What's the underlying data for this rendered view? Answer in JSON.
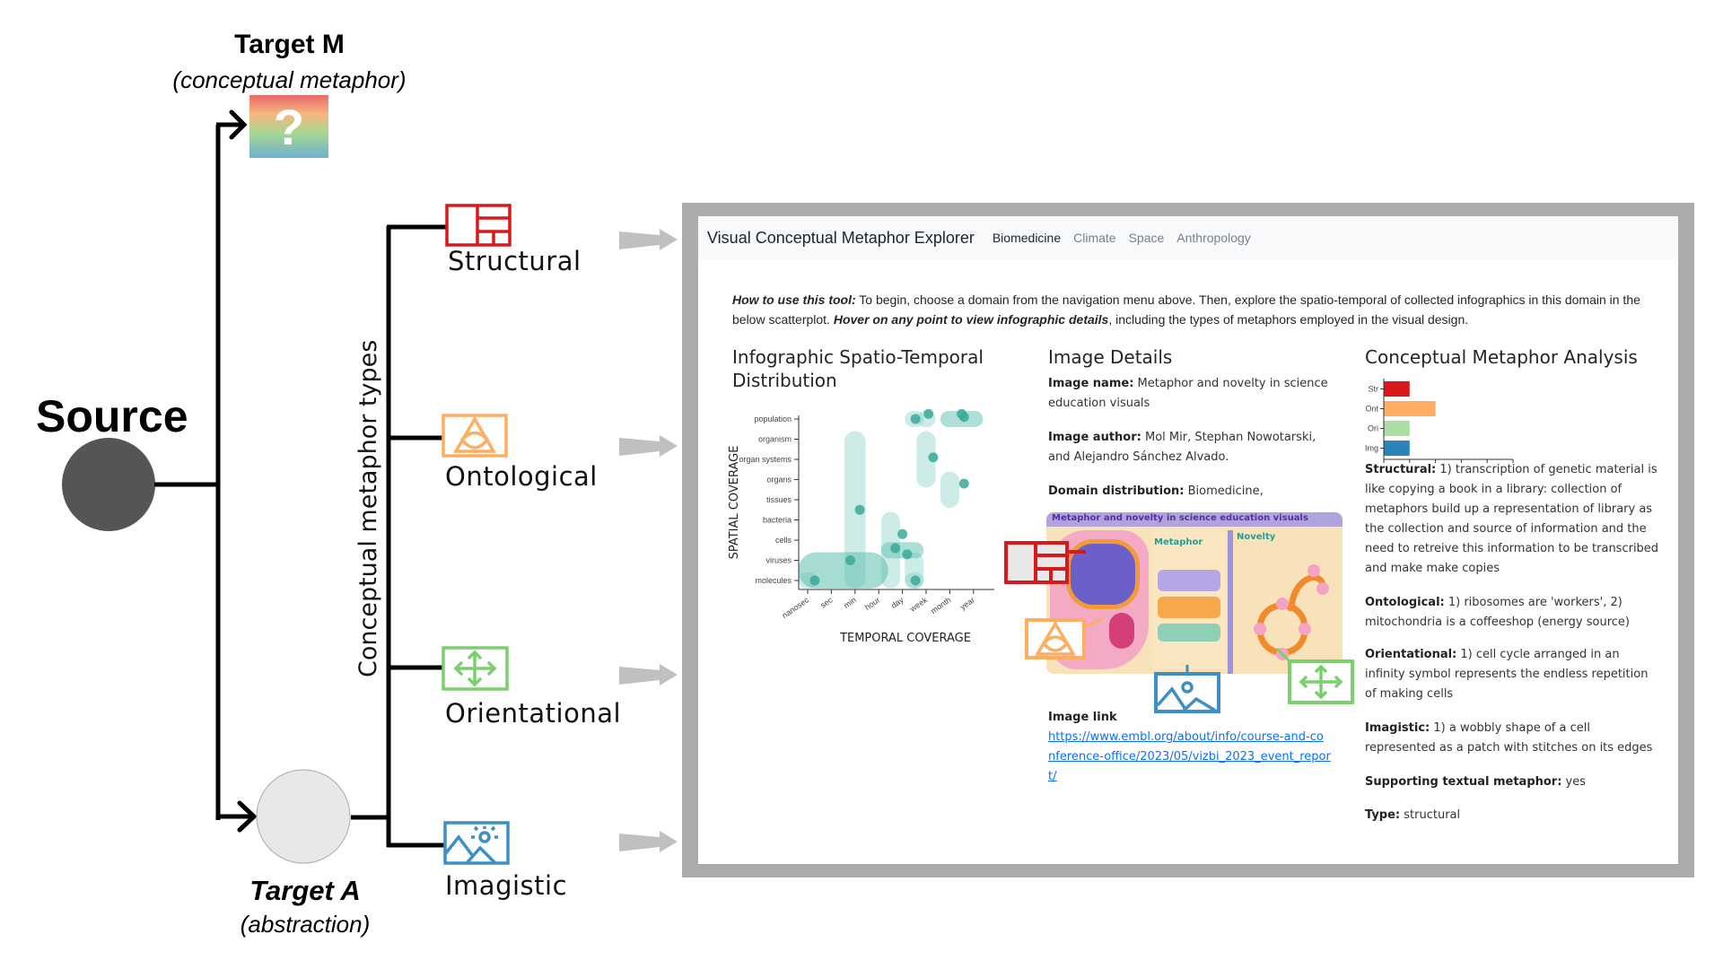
{
  "diagram": {
    "source": {
      "label": "Source"
    },
    "target_m": {
      "label": "Target M",
      "sublabel": "(conceptual metaphor)",
      "placeholder_glyph": "?"
    },
    "target_a": {
      "label": "Target A",
      "sublabel": "(abstraction)"
    },
    "branch_label": "Conceptual metaphor types",
    "types": [
      {
        "label": "Structural",
        "icon": "structural-grid-icon",
        "color": "#d7191c"
      },
      {
        "label": "Ontological",
        "icon": "ontological-triquetra-icon",
        "color": "#fdae61"
      },
      {
        "label": "Orientational",
        "icon": "orientational-arrows-icon",
        "color": "#7ccf6e"
      },
      {
        "label": "Imagistic",
        "icon": "imagistic-landscape-icon",
        "color": "#3d8fc4"
      }
    ]
  },
  "app": {
    "title": "Visual Conceptual Metaphor Explorer",
    "nav": [
      {
        "label": "Biomedicine",
        "active": true
      },
      {
        "label": "Climate",
        "active": false
      },
      {
        "label": "Space",
        "active": false
      },
      {
        "label": "Anthropology",
        "active": false
      }
    ],
    "intro": {
      "lead": "How to use this tool:",
      "part1": " To begin, choose a domain from the navigation menu above. Then, explore the spatio-temporal of collected infographics in this domain in the below scatterplot. ",
      "emph": "Hover on any point to view infographic details",
      "part2": ", including the types of metaphors employed in the visual design."
    },
    "scatter": {
      "title": "Infographic Spatio-Temporal Distribution"
    },
    "details": {
      "title": "Image Details",
      "name_label": "Image name:",
      "name_value": " Metaphor and novelty in science education visuals",
      "author_label": "Image author:",
      "author_value": " Mol Mir, Stephan Nowotarski, and Alejandro Sánchez Alvado.",
      "domain_label": "Domain distribution:",
      "domain_value": " Biomedicine,",
      "poster_title": "Metaphor and novelty in science education visuals",
      "poster_sections": [
        "Metaphor",
        "Novelty"
      ],
      "link_label": "Image link",
      "link_url": "https://www.embl.org/about/info/course-and-conference-office/2023/05/vizbi_2023_event_report/"
    },
    "analysis": {
      "title": "Conceptual Metaphor Analysis",
      "entries": [
        {
          "label": "Structural:",
          "text": " 1) transcription of genetic material is like copying a book in a library: collection of metaphors build up a representation of library as the collection and source of information and the need to retreive this information to be transcribed and make make copies"
        },
        {
          "label": "Ontological:",
          "text": " 1) ribosomes are 'workers', 2) mitochondria is a coffeeshop (energy source)"
        },
        {
          "label": "Orientational:",
          "text": " 1) cell cycle arranged in an infinity symbol represents the endless repetition of making cells"
        },
        {
          "label": "Imagistic:",
          "text": " 1) a wobbly shape of a cell represented as a patch with stitches on its edges"
        },
        {
          "label": "Supporting textual metaphor:",
          "text": " yes"
        },
        {
          "label": "Type:",
          "text": " structural"
        }
      ]
    }
  },
  "chart_data": [
    {
      "type": "scatter",
      "title": "Infographic Spatio-Temporal Distribution",
      "xlabel": "TEMPORAL COVERAGE",
      "ylabel": "SPATIAL COVERAGE",
      "x_categories": [
        "nanosec",
        "sec",
        "min",
        "hour",
        "day",
        "week",
        "month",
        "year"
      ],
      "y_categories": [
        "molecules",
        "viruses",
        "cells",
        "bacteria",
        "tissues",
        "organs",
        "organ systems",
        "organism",
        "population"
      ],
      "ranges": [
        {
          "x": [
            -0.4,
            3.4
          ],
          "y": [
            -0.4,
            1.4
          ],
          "emphasis": "strong"
        },
        {
          "x": [
            1.55,
            2.45
          ],
          "y": [
            -0.4,
            7.4
          ],
          "emphasis": "light"
        },
        {
          "x": [
            3.1,
            3.9
          ],
          "y": [
            -0.4,
            3.4
          ],
          "emphasis": "light"
        },
        {
          "x": [
            3.1,
            4.9
          ],
          "y": [
            1.1,
            1.9
          ],
          "emphasis": "medium"
        },
        {
          "x": [
            4.1,
            4.9
          ],
          "y": [
            -0.4,
            1.4
          ],
          "emphasis": "light"
        },
        {
          "x": [
            -0.4,
            0.4
          ],
          "y": [
            -0.4,
            0.4
          ],
          "emphasis": "light"
        },
        {
          "x": [
            4.1,
            4.9
          ],
          "y": [
            -0.4,
            0.4
          ],
          "emphasis": "light"
        },
        {
          "x": [
            4.6,
            5.4
          ],
          "y": [
            4.6,
            7.4
          ],
          "emphasis": "light"
        },
        {
          "x": [
            5.6,
            6.4
          ],
          "y": [
            3.6,
            5.4
          ],
          "emphasis": "light"
        },
        {
          "x": [
            4.1,
            4.9
          ],
          "y": [
            7.6,
            8.4
          ],
          "emphasis": "light"
        },
        {
          "x": [
            4.6,
            5.4
          ],
          "y": [
            7.6,
            8.4
          ],
          "emphasis": "light"
        },
        {
          "x": [
            5.6,
            7.4
          ],
          "y": [
            7.6,
            8.4
          ],
          "emphasis": "medium"
        }
      ],
      "points": [
        {
          "x": 0.3,
          "y": 0
        },
        {
          "x": 1.8,
          "y": 1
        },
        {
          "x": 2.2,
          "y": 3.5
        },
        {
          "x": 3.7,
          "y": 1.6
        },
        {
          "x": 4.0,
          "y": 2.3
        },
        {
          "x": 4.2,
          "y": 1.3
        },
        {
          "x": 4.55,
          "y": 0
        },
        {
          "x": 4.55,
          "y": 8
        },
        {
          "x": 5.1,
          "y": 8.25
        },
        {
          "x": 5.3,
          "y": 6.1
        },
        {
          "x": 6.5,
          "y": 8.25
        },
        {
          "x": 6.6,
          "y": 8.1
        },
        {
          "x": 6.6,
          "y": 4.8
        }
      ]
    },
    {
      "type": "bar",
      "title": "Conceptual Metaphor Analysis",
      "orientation": "horizontal",
      "categories": [
        "Str",
        "Ont",
        "Ori",
        "Img"
      ],
      "values": [
        1,
        2,
        1,
        1
      ],
      "colors": [
        "#d7191c",
        "#fdae61",
        "#abdda4",
        "#2b83ba"
      ],
      "xlim": [
        0,
        5
      ],
      "xticks": [
        0,
        1,
        2,
        3,
        4,
        5
      ]
    }
  ]
}
